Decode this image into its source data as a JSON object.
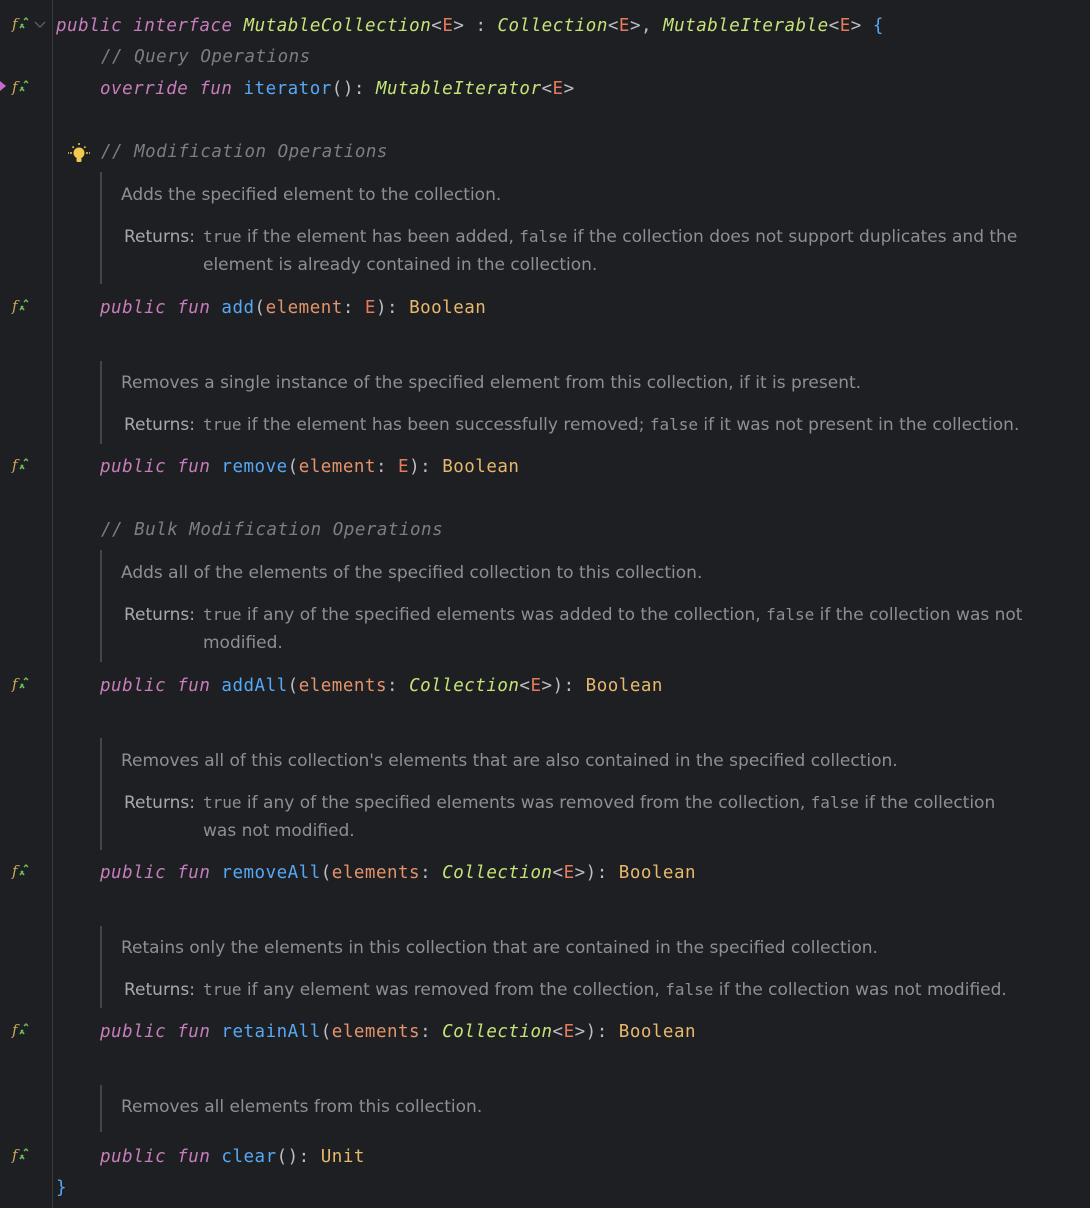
{
  "code": {
    "header": {
      "kw_public": "public",
      "kw_interface": "interface",
      "name": "MutableCollection",
      "tp_open": "<",
      "tp": "E",
      "tp_close": ">",
      "colon": " : ",
      "super1": "Collection",
      "super1_tp": "E",
      "comma": ", ",
      "super2": "MutableIterable",
      "super2_tp": "E",
      "brace_open": "{"
    },
    "query_comment": "// Query Operations",
    "iterator": {
      "kw_override": "override",
      "kw_fun": "fun",
      "name": "iterator",
      "sig": "(): ",
      "ret": "MutableIterator",
      "ret_tp": "E"
    },
    "modification_comment": "// Modification Operations",
    "bulk_comment": "// Bulk Modification Operations",
    "closing_brace": "}"
  },
  "members": [
    {
      "kw_public": "public",
      "kw_fun": "fun",
      "name": "add",
      "param": "element",
      "param_type": "E",
      "param_generic": "",
      "ret": "Boolean",
      "doc_summary": "Adds the specified element to the collection.",
      "returns_label": "Returns:",
      "ret_true": "true",
      "ret_mid": " if the element has been added, ",
      "ret_false": "false",
      "ret_end": " if the collection does not support duplicates and the element is already contained in the collection."
    },
    {
      "kw_public": "public",
      "kw_fun": "fun",
      "name": "remove",
      "param": "element",
      "param_type": "E",
      "param_generic": "",
      "ret": "Boolean",
      "doc_summary": "Removes a single instance of the specified element from this collection, if it is present.",
      "returns_label": "Returns:",
      "ret_true": "true",
      "ret_mid": " if the element has been successfully removed; ",
      "ret_false": "false",
      "ret_end": " if it was not present in the collection."
    },
    {
      "kw_public": "public",
      "kw_fun": "fun",
      "name": "addAll",
      "param": "elements",
      "param_type": "Collection",
      "param_generic": "E",
      "ret": "Boolean",
      "doc_summary": "Adds all of the elements of the specified collection to this collection.",
      "returns_label": "Returns:",
      "ret_true": "true",
      "ret_mid": " if any of the specified elements was added to the collection, ",
      "ret_false": "false",
      "ret_end": " if the collection was not modified."
    },
    {
      "kw_public": "public",
      "kw_fun": "fun",
      "name": "removeAll",
      "param": "elements",
      "param_type": "Collection",
      "param_generic": "E",
      "ret": "Boolean",
      "doc_summary": "Removes all of this collection's elements that are also contained in the specified collection.",
      "returns_label": "Returns:",
      "ret_true": "true",
      "ret_mid": " if any of the specified elements was removed from the collection, ",
      "ret_false": "false",
      "ret_end": " if the collection was not modified."
    },
    {
      "kw_public": "public",
      "kw_fun": "fun",
      "name": "retainAll",
      "param": "elements",
      "param_type": "Collection",
      "param_generic": "E",
      "ret": "Boolean",
      "doc_summary": "Retains only the elements in this collection that are contained in the specified collection.",
      "returns_label": "Returns:",
      "ret_true": "true",
      "ret_mid": " if any element was removed from the collection, ",
      "ret_false": "false",
      "ret_end": " if the collection was not modified."
    },
    {
      "kw_public": "public",
      "kw_fun": "fun",
      "name": "clear",
      "sig": "(): ",
      "ret": "Unit",
      "doc_summary": "Removes all elements from this collection."
    }
  ],
  "icons": {
    "gutter": "function-implemented-icon",
    "fold": "fold-chevron-icon",
    "override": "override-marker-icon",
    "intention": "lightbulb-icon"
  },
  "colors": {
    "background": "#1e1f22",
    "keyword": "#c77dbb",
    "type": "#c5e478",
    "function": "#56a8f5",
    "parameter": "#e5936a",
    "builtin_type": "#e8b86d",
    "comment": "#7a7e85",
    "lightbulb": "#f2c94c"
  }
}
